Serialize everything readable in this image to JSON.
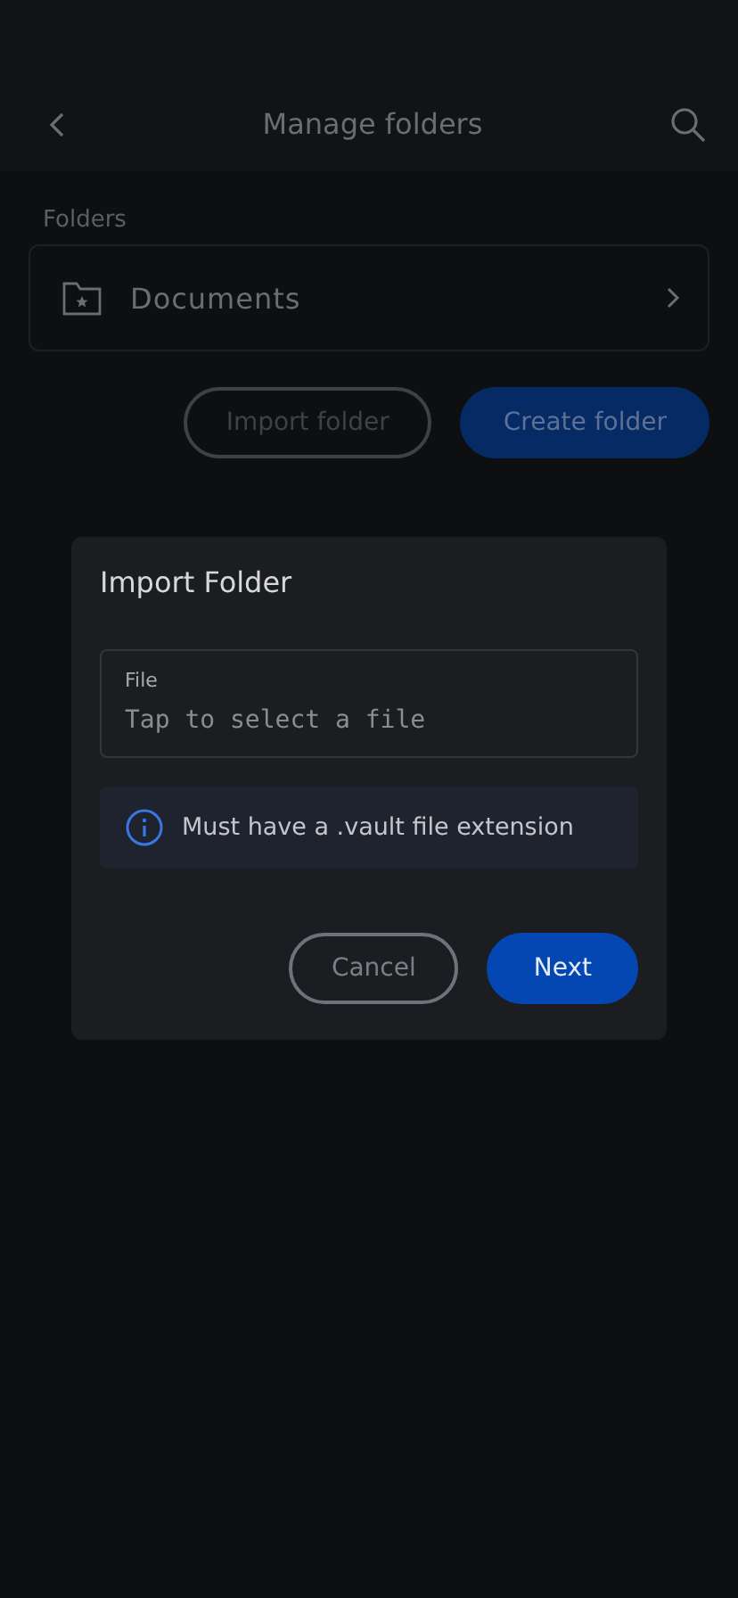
{
  "header": {
    "title": "Manage folders"
  },
  "folders": {
    "label": "Folders",
    "items": [
      {
        "name": "Documents"
      }
    ]
  },
  "actions": [
    {
      "label": "Import folder",
      "kind": "outlined"
    },
    {
      "label": "Create folder",
      "kind": "filled"
    }
  ],
  "dialog": {
    "title": "Import Folder",
    "field": {
      "label": "File",
      "placeholder": "Tap to select a file"
    },
    "info": "Must have a .vault file extension",
    "buttons": [
      {
        "label": "Cancel",
        "kind": "outlined"
      },
      {
        "label": "Next",
        "kind": "filled"
      }
    ]
  }
}
